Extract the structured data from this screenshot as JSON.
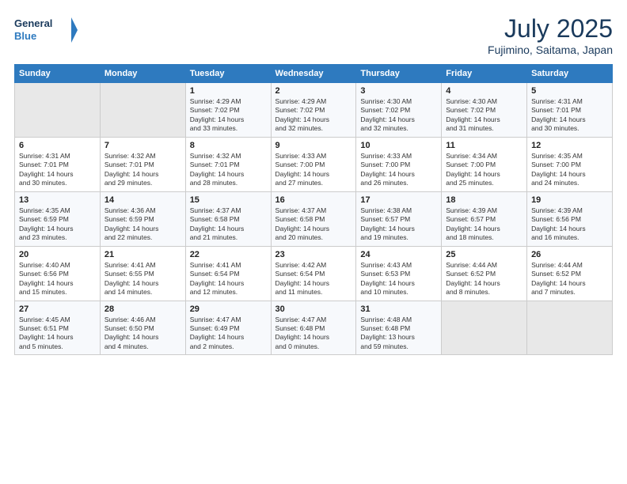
{
  "logo": {
    "line1": "General",
    "line2": "Blue"
  },
  "title": "July 2025",
  "subtitle": "Fujimino, Saitama, Japan",
  "days_header": [
    "Sunday",
    "Monday",
    "Tuesday",
    "Wednesday",
    "Thursday",
    "Friday",
    "Saturday"
  ],
  "weeks": [
    [
      {
        "day": "",
        "info": ""
      },
      {
        "day": "",
        "info": ""
      },
      {
        "day": "1",
        "info": "Sunrise: 4:29 AM\nSunset: 7:02 PM\nDaylight: 14 hours\nand 33 minutes."
      },
      {
        "day": "2",
        "info": "Sunrise: 4:29 AM\nSunset: 7:02 PM\nDaylight: 14 hours\nand 32 minutes."
      },
      {
        "day": "3",
        "info": "Sunrise: 4:30 AM\nSunset: 7:02 PM\nDaylight: 14 hours\nand 32 minutes."
      },
      {
        "day": "4",
        "info": "Sunrise: 4:30 AM\nSunset: 7:02 PM\nDaylight: 14 hours\nand 31 minutes."
      },
      {
        "day": "5",
        "info": "Sunrise: 4:31 AM\nSunset: 7:01 PM\nDaylight: 14 hours\nand 30 minutes."
      }
    ],
    [
      {
        "day": "6",
        "info": "Sunrise: 4:31 AM\nSunset: 7:01 PM\nDaylight: 14 hours\nand 30 minutes."
      },
      {
        "day": "7",
        "info": "Sunrise: 4:32 AM\nSunset: 7:01 PM\nDaylight: 14 hours\nand 29 minutes."
      },
      {
        "day": "8",
        "info": "Sunrise: 4:32 AM\nSunset: 7:01 PM\nDaylight: 14 hours\nand 28 minutes."
      },
      {
        "day": "9",
        "info": "Sunrise: 4:33 AM\nSunset: 7:00 PM\nDaylight: 14 hours\nand 27 minutes."
      },
      {
        "day": "10",
        "info": "Sunrise: 4:33 AM\nSunset: 7:00 PM\nDaylight: 14 hours\nand 26 minutes."
      },
      {
        "day": "11",
        "info": "Sunrise: 4:34 AM\nSunset: 7:00 PM\nDaylight: 14 hours\nand 25 minutes."
      },
      {
        "day": "12",
        "info": "Sunrise: 4:35 AM\nSunset: 7:00 PM\nDaylight: 14 hours\nand 24 minutes."
      }
    ],
    [
      {
        "day": "13",
        "info": "Sunrise: 4:35 AM\nSunset: 6:59 PM\nDaylight: 14 hours\nand 23 minutes."
      },
      {
        "day": "14",
        "info": "Sunrise: 4:36 AM\nSunset: 6:59 PM\nDaylight: 14 hours\nand 22 minutes."
      },
      {
        "day": "15",
        "info": "Sunrise: 4:37 AM\nSunset: 6:58 PM\nDaylight: 14 hours\nand 21 minutes."
      },
      {
        "day": "16",
        "info": "Sunrise: 4:37 AM\nSunset: 6:58 PM\nDaylight: 14 hours\nand 20 minutes."
      },
      {
        "day": "17",
        "info": "Sunrise: 4:38 AM\nSunset: 6:57 PM\nDaylight: 14 hours\nand 19 minutes."
      },
      {
        "day": "18",
        "info": "Sunrise: 4:39 AM\nSunset: 6:57 PM\nDaylight: 14 hours\nand 18 minutes."
      },
      {
        "day": "19",
        "info": "Sunrise: 4:39 AM\nSunset: 6:56 PM\nDaylight: 14 hours\nand 16 minutes."
      }
    ],
    [
      {
        "day": "20",
        "info": "Sunrise: 4:40 AM\nSunset: 6:56 PM\nDaylight: 14 hours\nand 15 minutes."
      },
      {
        "day": "21",
        "info": "Sunrise: 4:41 AM\nSunset: 6:55 PM\nDaylight: 14 hours\nand 14 minutes."
      },
      {
        "day": "22",
        "info": "Sunrise: 4:41 AM\nSunset: 6:54 PM\nDaylight: 14 hours\nand 12 minutes."
      },
      {
        "day": "23",
        "info": "Sunrise: 4:42 AM\nSunset: 6:54 PM\nDaylight: 14 hours\nand 11 minutes."
      },
      {
        "day": "24",
        "info": "Sunrise: 4:43 AM\nSunset: 6:53 PM\nDaylight: 14 hours\nand 10 minutes."
      },
      {
        "day": "25",
        "info": "Sunrise: 4:44 AM\nSunset: 6:52 PM\nDaylight: 14 hours\nand 8 minutes."
      },
      {
        "day": "26",
        "info": "Sunrise: 4:44 AM\nSunset: 6:52 PM\nDaylight: 14 hours\nand 7 minutes."
      }
    ],
    [
      {
        "day": "27",
        "info": "Sunrise: 4:45 AM\nSunset: 6:51 PM\nDaylight: 14 hours\nand 5 minutes."
      },
      {
        "day": "28",
        "info": "Sunrise: 4:46 AM\nSunset: 6:50 PM\nDaylight: 14 hours\nand 4 minutes."
      },
      {
        "day": "29",
        "info": "Sunrise: 4:47 AM\nSunset: 6:49 PM\nDaylight: 14 hours\nand 2 minutes."
      },
      {
        "day": "30",
        "info": "Sunrise: 4:47 AM\nSunset: 6:48 PM\nDaylight: 14 hours\nand 0 minutes."
      },
      {
        "day": "31",
        "info": "Sunrise: 4:48 AM\nSunset: 6:48 PM\nDaylight: 13 hours\nand 59 minutes."
      },
      {
        "day": "",
        "info": ""
      },
      {
        "day": "",
        "info": ""
      }
    ]
  ]
}
